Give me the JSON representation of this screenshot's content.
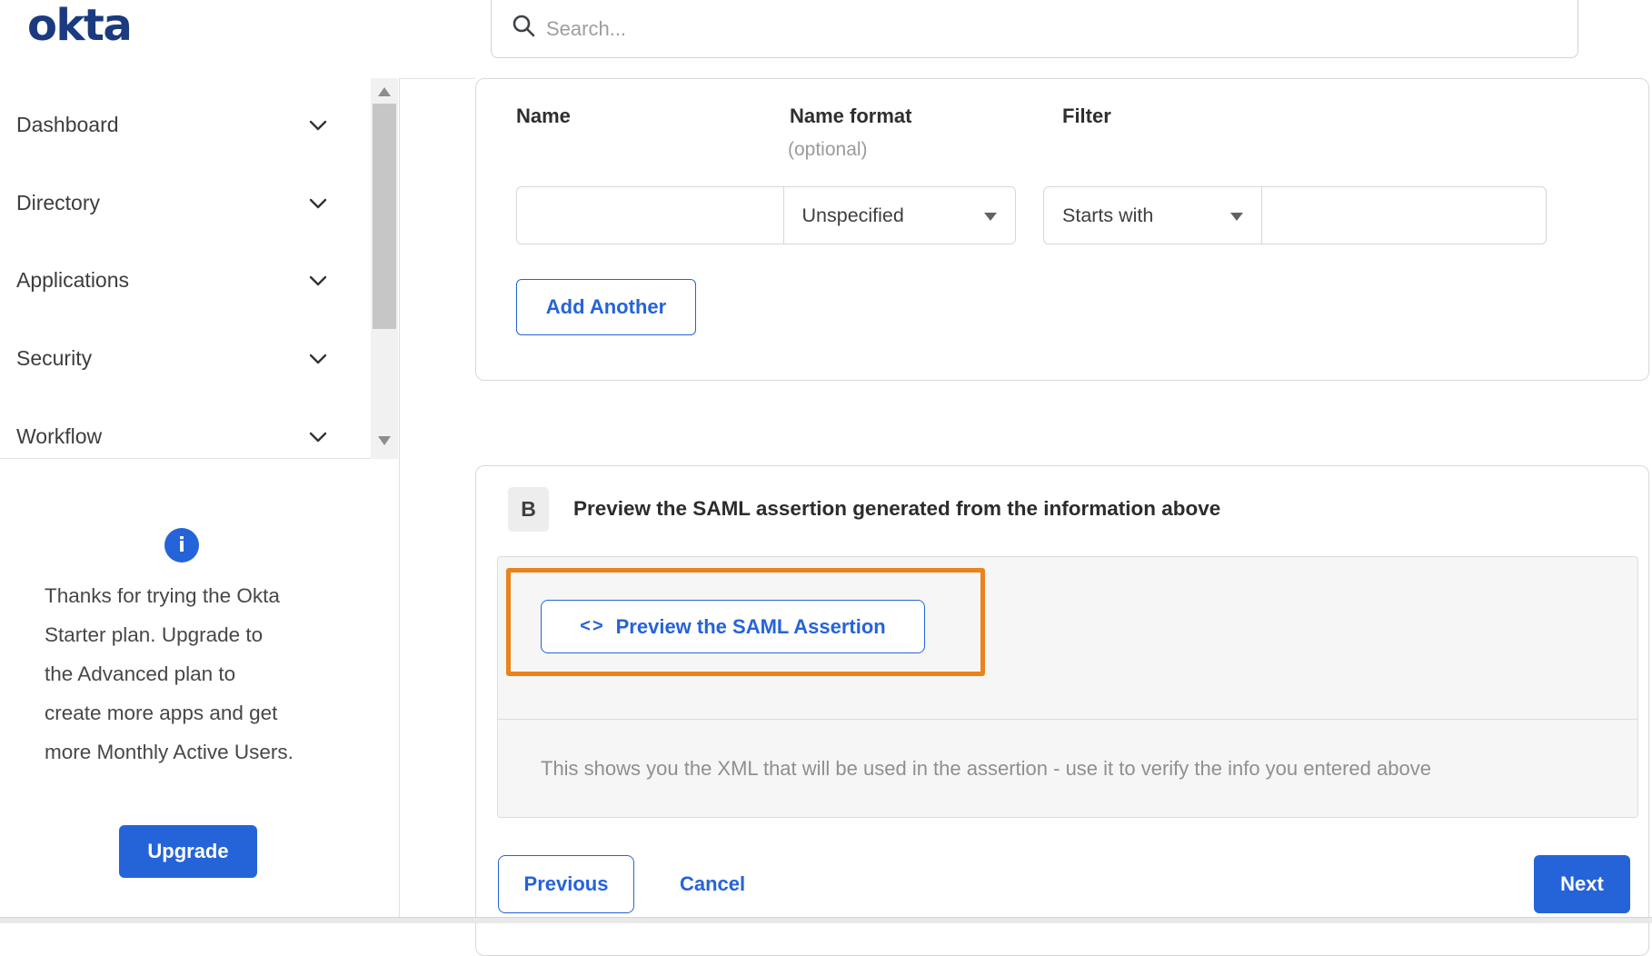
{
  "brand": {
    "logo_text": "okta"
  },
  "search": {
    "placeholder": "Search..."
  },
  "sidebar": {
    "items": [
      {
        "label": "Dashboard"
      },
      {
        "label": "Directory"
      },
      {
        "label": "Applications"
      },
      {
        "label": "Security"
      },
      {
        "label": "Workflow"
      }
    ],
    "upsell": {
      "info_glyph": "i",
      "message_lines": [
        "Thanks for trying the Okta",
        "Starter plan. Upgrade to",
        "the Advanced plan to",
        "create more apps and get",
        "more Monthly Active Users."
      ],
      "button_label": "Upgrade"
    }
  },
  "attribute_form": {
    "columns": {
      "name_label": "Name",
      "name_format_label": "Name format",
      "name_format_sublabel": "(optional)",
      "filter_label": "Filter"
    },
    "row": {
      "name_value": "",
      "name_format_selected": "Unspecified",
      "filter_type_selected": "Starts with",
      "filter_value": ""
    },
    "add_button_label": "Add Another"
  },
  "preview_section": {
    "badge": "B",
    "title": "Preview the SAML assertion generated from the information above",
    "button_icon_glyph": "<>",
    "button_label": "Preview the SAML Assertion",
    "hint": "This shows you the XML that will be used in the assertion - use it to verify the info you entered above"
  },
  "footer": {
    "previous_label": "Previous",
    "cancel_label": "Cancel",
    "next_label": "Next"
  },
  "colors": {
    "accent_blue": "#2563d9",
    "logo_navy": "#1b3a80",
    "highlight_orange": "#e8831d"
  }
}
